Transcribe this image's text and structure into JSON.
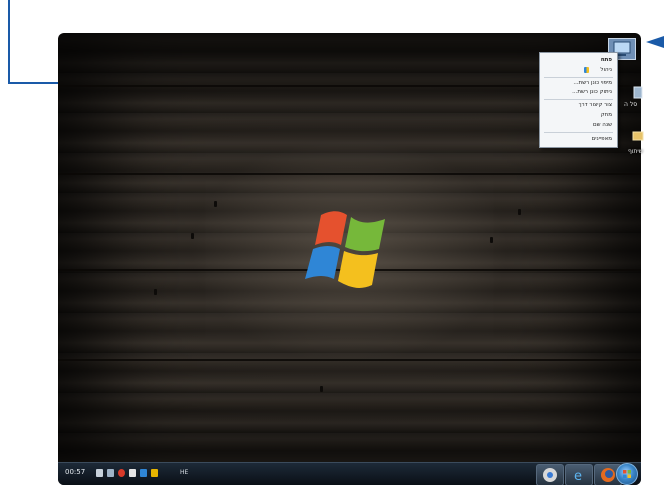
{
  "taskbar": {
    "clock": "00:57",
    "language": "HE"
  },
  "desktop": {
    "icons": [
      {
        "label": "",
        "icon": "computer-icon"
      },
      {
        "label": "סל ה",
        "icon": "recycle-bin-icon"
      },
      {
        "label": "שיתוף",
        "icon": "folder-icon"
      }
    ]
  },
  "context_menu": {
    "items": [
      {
        "label": "פתח",
        "bold": true
      },
      {
        "label": "ניהול",
        "icon": "shield-icon"
      },
      {
        "label": "מיפוי כונן רשת..."
      },
      {
        "label": "ניתוק כונן רשת..."
      },
      {
        "label": "צור קיצור דרך"
      },
      {
        "label": "מחק"
      },
      {
        "label": "שנה שם"
      },
      {
        "label": "מאפיינים"
      }
    ]
  },
  "colors": {
    "annotation_arrow": "#1a5aa8",
    "taskbar": "#0e1620",
    "menu_bg": "#f4f6f8"
  }
}
